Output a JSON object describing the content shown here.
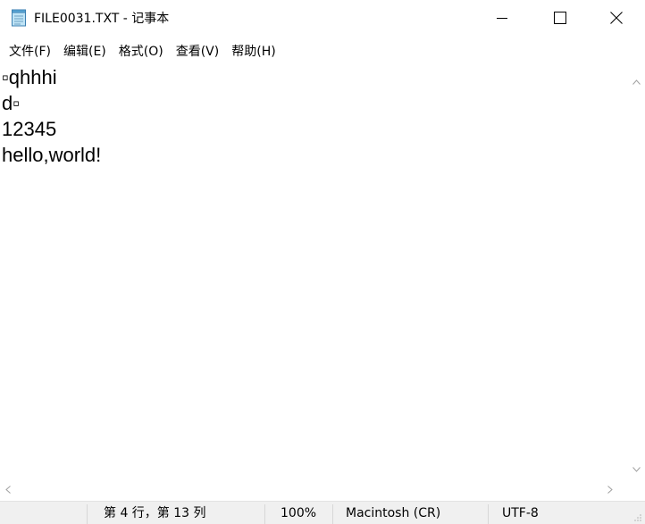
{
  "window": {
    "title": "FILE0031.TXT - 记事本",
    "icon": "notepad-icon",
    "controls": {
      "minimize": "minimize-icon",
      "maximize": "maximize-icon",
      "close": "close-icon"
    }
  },
  "menu": {
    "items": [
      {
        "label": "文件(F)"
      },
      {
        "label": "编辑(E)"
      },
      {
        "label": "格式(O)"
      },
      {
        "label": "查看(V)"
      },
      {
        "label": "帮助(H)"
      }
    ]
  },
  "editor": {
    "lines": [
      "▫qhhhi",
      "d▫",
      "12345",
      "hello,world!"
    ]
  },
  "status": {
    "position": "第 4 行，第 13 列",
    "zoom": "100%",
    "line_ending": "Macintosh (CR)",
    "encoding": "UTF-8"
  }
}
